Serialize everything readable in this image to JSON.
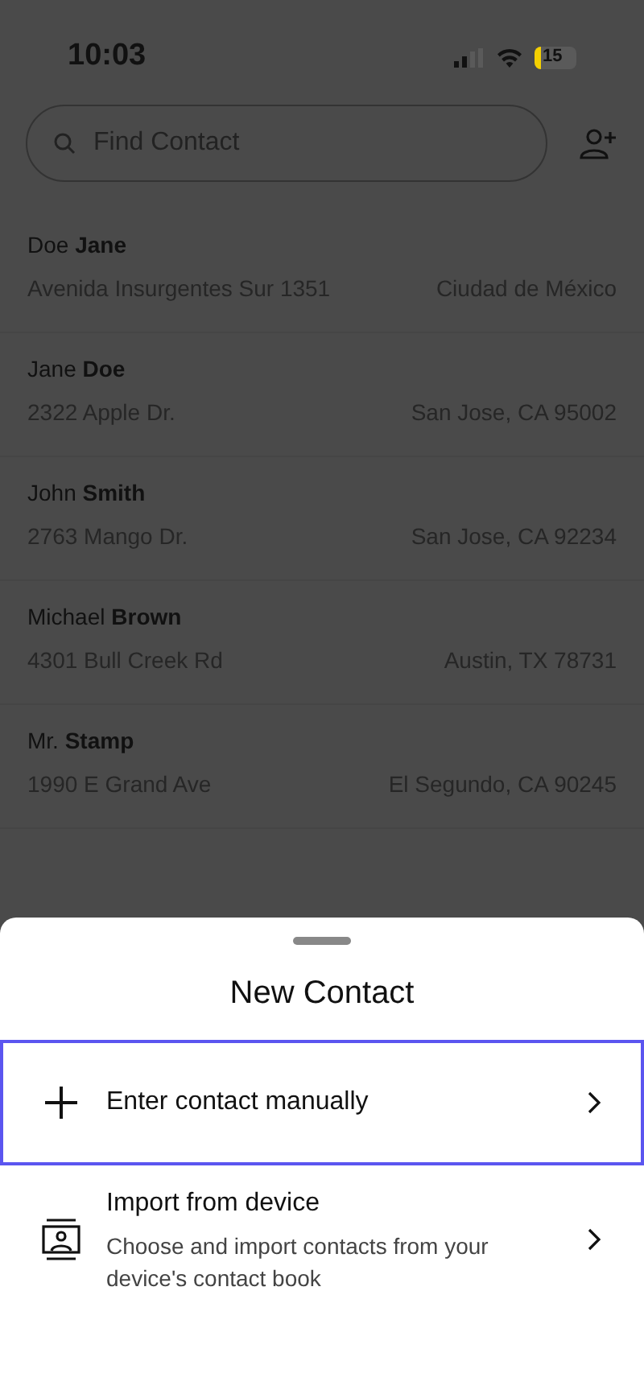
{
  "status_bar": {
    "time": "10:03",
    "battery": "15"
  },
  "search": {
    "placeholder": "Find Contact"
  },
  "contacts": [
    {
      "name": "Doe **Jane**",
      "street": "Avenida Insurgentes Sur 1351",
      "city": "Ciudad de México"
    },
    {
      "name": "Jane **Doe**",
      "street": "2322 Apple Dr.",
      "city": "San Jose, CA 95002"
    },
    {
      "name": "John **Smith**",
      "street": "2763 Mango Dr.",
      "city": "San Jose, CA 92234"
    },
    {
      "name": "Michael **Brown**",
      "street": "4301 Bull Creek Rd",
      "city": "Austin, TX 78731"
    },
    {
      "name": "Mr. **Stamp**",
      "street": "1990 E Grand Ave",
      "city": "El Segundo, CA 90245"
    }
  ],
  "sheet": {
    "title": "New Contact",
    "options": [
      {
        "kind": "manual",
        "label": "Enter contact manually",
        "selected": true
      },
      {
        "kind": "import",
        "label": "Import from device",
        "description": "Choose and import contacts from your device's contact book",
        "selected": false
      }
    ]
  }
}
